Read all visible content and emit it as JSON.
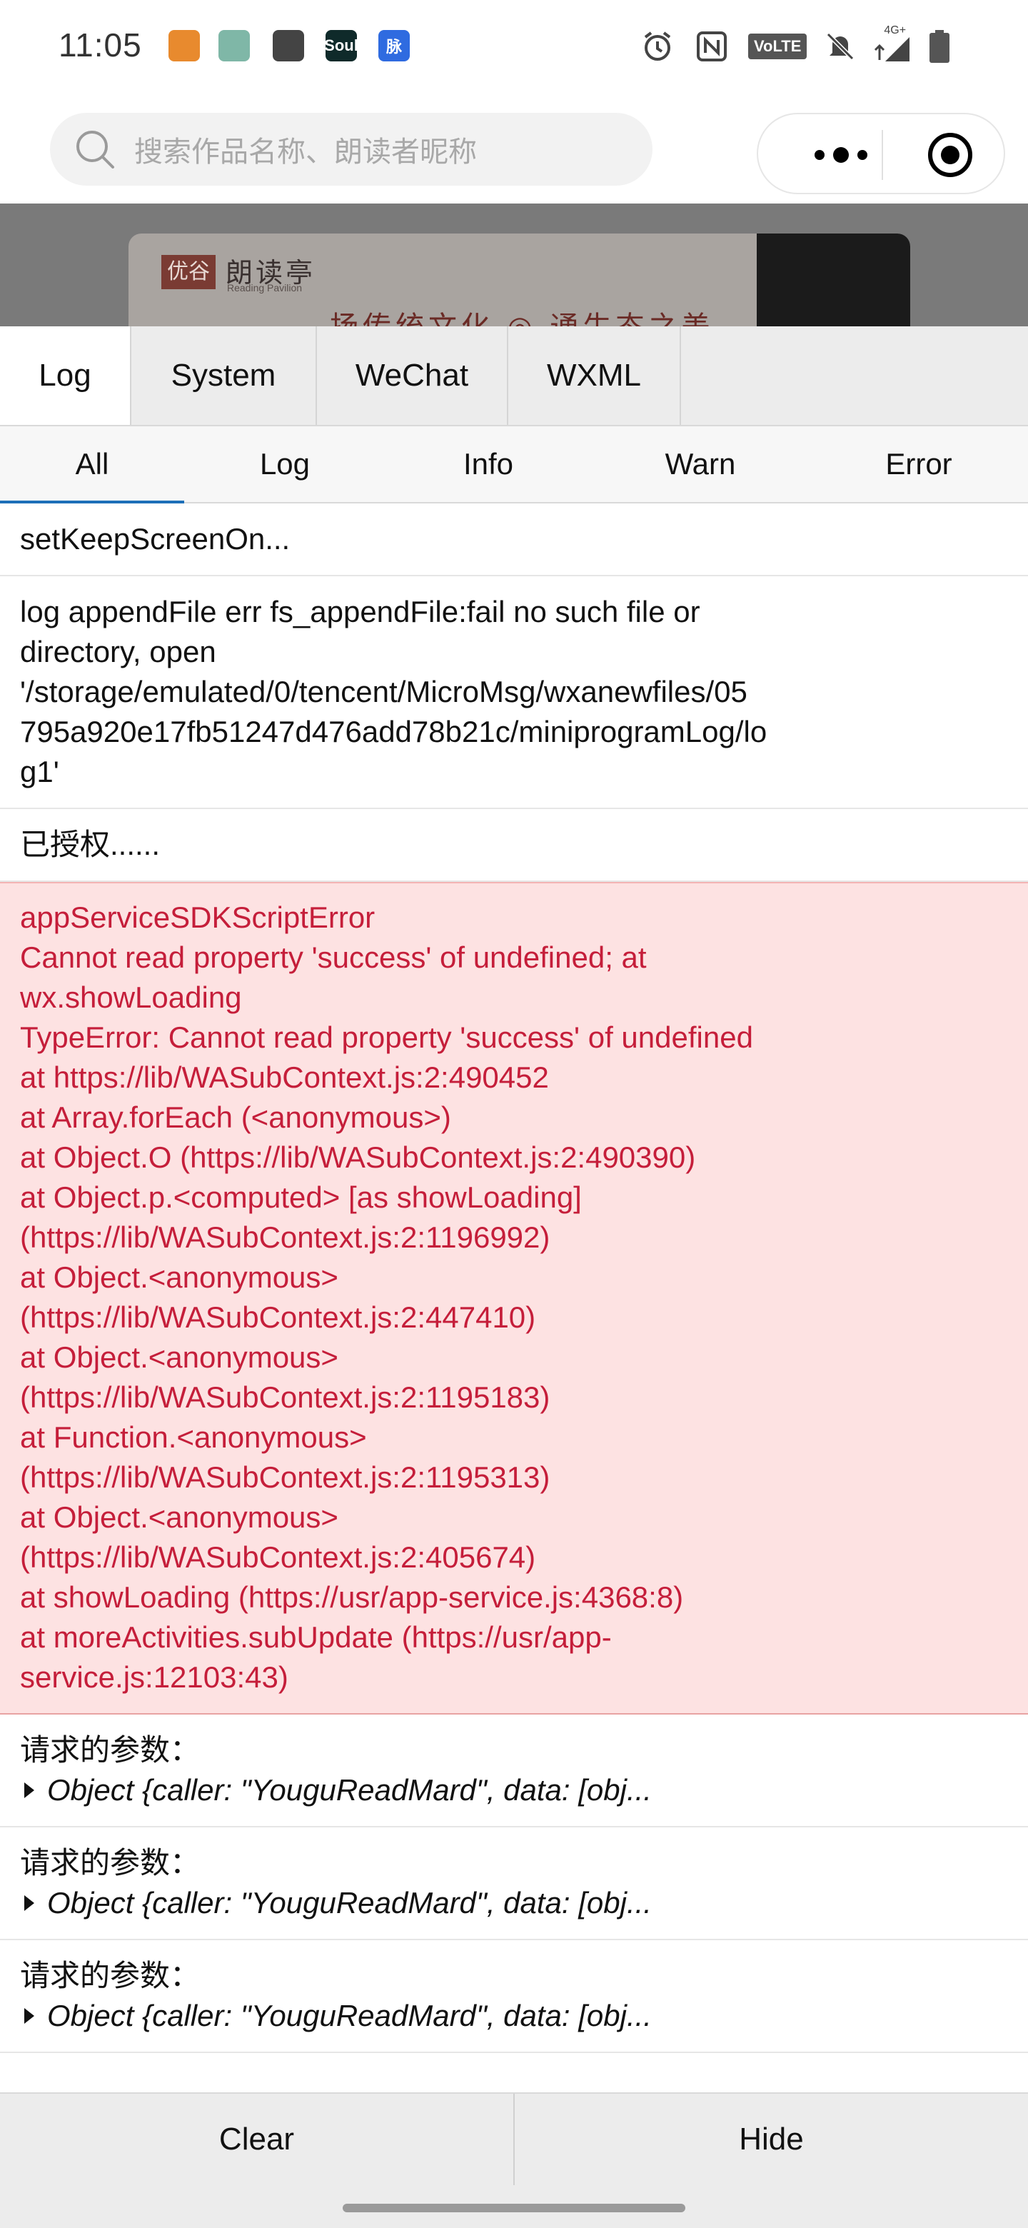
{
  "status_bar": {
    "time": "11:05",
    "app_icons": [
      {
        "icon": "arrow-app-icon",
        "color": "#e88a2e",
        "label": ""
      },
      {
        "icon": "forest-app-icon",
        "color": "#7fb7a7",
        "label": ""
      },
      {
        "icon": "message-app-icon",
        "color": "#444444",
        "label": ""
      },
      {
        "icon": "soul-app-icon",
        "color": "#0f2a2a",
        "label": "Soul"
      },
      {
        "icon": "maimai-app-icon",
        "color": "#2f6be0",
        "label": "脉"
      }
    ],
    "network_label": "4G+",
    "volte_label": "VoLTE",
    "right_icons": [
      "alarm-icon",
      "nfc-icon",
      "volte-icon",
      "mute-icon",
      "signal-icon",
      "battery-icon"
    ]
  },
  "search": {
    "placeholder": "搜索作品名称、朗读者昵称"
  },
  "capsule": {
    "more_icon": "more-dots-icon",
    "close_icon": "target-circle-icon"
  },
  "banner": {
    "logo_mark": "优谷",
    "logo_title": "朗读亭",
    "logo_subtitle": "Reading Pavilion",
    "slogan": "扬传统文化 ◎ 通生态之美"
  },
  "tabs": [
    "Log",
    "System",
    "WeChat",
    "WXML"
  ],
  "active_tab": "Log",
  "subtabs": [
    "All",
    "Log",
    "Info",
    "Warn",
    "Error"
  ],
  "active_subtab": "All",
  "logs": [
    {
      "type": "log",
      "lines": [
        "setKeepScreenOn..."
      ]
    },
    {
      "type": "log",
      "lines": [
        "log appendFile err fs_appendFile:fail no such file or",
        "directory, open",
        "'/storage/emulated/0/tencent/MicroMsg/wxanewfiles/05",
        "795a920e17fb51247d476add78b21c/miniprogramLog/lo",
        "g1'"
      ]
    },
    {
      "type": "log",
      "lines": [
        "已授权......"
      ]
    },
    {
      "type": "error",
      "lines": [
        "appServiceSDKScriptError",
        "Cannot read property 'success' of undefined; at",
        "wx.showLoading",
        "TypeError: Cannot read property 'success' of undefined",
        "at https://lib/WASubContext.js:2:490452",
        "at Array.forEach (<anonymous>)",
        "at Object.O (https://lib/WASubContext.js:2:490390)",
        "at Object.p.<computed> [as showLoading]",
        "(https://lib/WASubContext.js:2:1196992)",
        "at Object.<anonymous>",
        "(https://lib/WASubContext.js:2:447410)",
        "at Object.<anonymous>",
        "(https://lib/WASubContext.js:2:1195183)",
        "at Function.<anonymous>",
        "(https://lib/WASubContext.js:2:1195313)",
        "at Object.<anonymous>",
        "(https://lib/WASubContext.js:2:405674)",
        "at showLoading (https://usr/app-service.js:4368:8)",
        "at moreActivities.subUpdate (https://usr/app-",
        "service.js:12103:43)"
      ]
    },
    {
      "type": "object",
      "label": "请求的参数：",
      "object": "Object {caller: \"YouguReadMard\", data: [obj..."
    },
    {
      "type": "object",
      "label": "请求的参数：",
      "object": "Object {caller: \"YouguReadMard\", data: [obj..."
    },
    {
      "type": "object",
      "label": "请求的参数：",
      "object": "Object {caller: \"YouguReadMard\", data: [obj..."
    }
  ],
  "buttons": {
    "clear": "Clear",
    "hide": "Hide"
  },
  "colors": {
    "error_bg": "#fde2e2",
    "error_text": "#c51e3a",
    "accent": "#1d6fb8"
  }
}
